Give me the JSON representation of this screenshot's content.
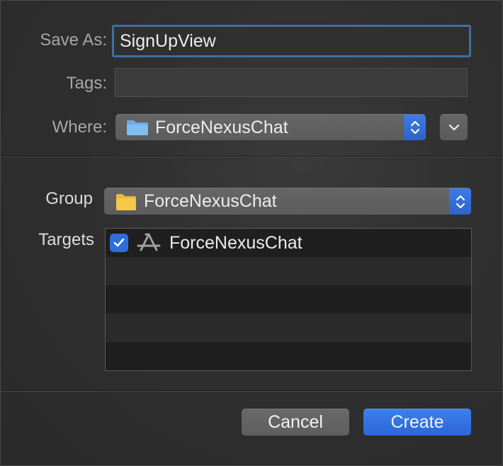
{
  "form": {
    "save_as_label": "Save As:",
    "save_as_value": "SignUpView",
    "tags_label": "Tags:",
    "tags_value": "",
    "where_label": "Where:",
    "where_value": "ForceNexusChat"
  },
  "group": {
    "label": "Group",
    "value": "ForceNexusChat"
  },
  "targets": {
    "label": "Targets",
    "items": [
      {
        "name": "ForceNexusChat",
        "checked": true
      }
    ]
  },
  "buttons": {
    "cancel": "Cancel",
    "create": "Create"
  },
  "colors": {
    "accent": "#2f6cde",
    "folder_blue": "#6aaee6",
    "folder_yellow": "#f5c84a"
  }
}
